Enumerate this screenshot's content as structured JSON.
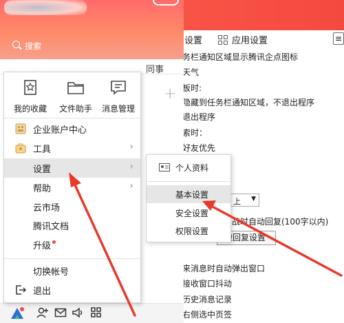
{
  "settings_window": {
    "tabs": {
      "basic": "设置",
      "app": "应用设置"
    },
    "more": "≡",
    "lines": [
      "务栏通知区域显示腾讯企点图标",
      "天气",
      "板时:",
      "隐藏到任务栏通知区域，不退出程序",
      "退出程序",
      "索时：",
      "好友优先",
      "战时自动回复(100字以内)",
      "来消息时自动弹出窗口",
      "接收窗口抖动",
      "历史消息记录",
      "右侧选中页签"
    ],
    "dropdown_value": "上",
    "quick_reply_label": "捷回复设置"
  },
  "panel": {
    "search_placeholder": "搜索",
    "tab_group": "同事"
  },
  "menu": {
    "quick_actions": [
      {
        "label": "我的收藏",
        "icon": "bookmark-icon"
      },
      {
        "label": "文件助手",
        "icon": "folder-icon"
      },
      {
        "label": "消息管理",
        "icon": "message-icon"
      }
    ],
    "items": [
      {
        "label": "企业账户中心",
        "icon": "enterprise-icon",
        "has_submenu": false
      },
      {
        "label": "工具",
        "icon": "toolbox-icon",
        "has_submenu": true
      },
      {
        "label": "设置",
        "icon": "",
        "has_submenu": true,
        "active": true
      },
      {
        "label": "帮助",
        "icon": "",
        "has_submenu": true
      },
      {
        "label": "云市场",
        "icon": "",
        "has_submenu": false
      },
      {
        "label": "腾讯文档",
        "icon": "",
        "has_submenu": false
      },
      {
        "label": "升级",
        "icon": "",
        "has_submenu": false,
        "badge": true
      },
      {
        "label": "切换帐号",
        "icon": "",
        "has_submenu": false
      },
      {
        "label": "退出",
        "icon": "exit-icon",
        "has_submenu": false
      }
    ]
  },
  "submenu": {
    "items": [
      {
        "label": "个人资料",
        "icon": "profile-card-icon"
      },
      {
        "label": "基本设置",
        "active": true
      },
      {
        "label": "安全设置"
      },
      {
        "label": "权限设置"
      }
    ]
  },
  "colors": {
    "header_red": "#f4493f",
    "arrow_red": "#e8392b"
  }
}
